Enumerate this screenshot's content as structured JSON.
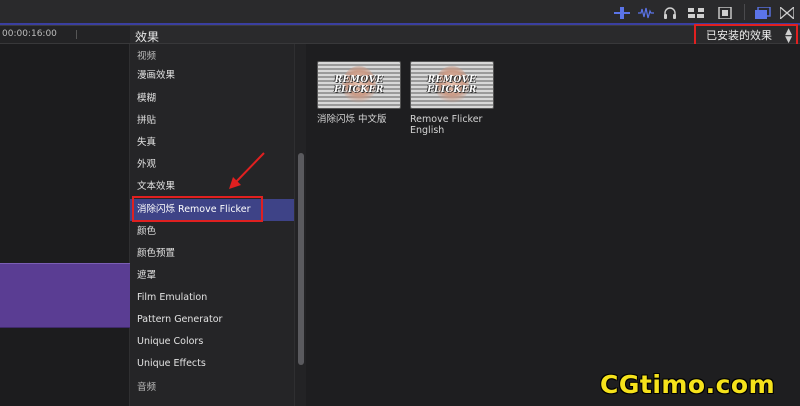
{
  "toolbar": {
    "icons": [
      "skimming-icon",
      "audio-skimming-icon",
      "headphones-icon",
      "snapping-icon",
      "clip-appearance-icon",
      "browser-toggle-icon",
      "transitions-icon"
    ]
  },
  "timeline": {
    "timecode": "00:00:16:00"
  },
  "effects": {
    "title": "效果",
    "filter_label": "已安装的效果",
    "categories": [
      {
        "label": "视频"
      },
      {
        "label": "漫画效果"
      },
      {
        "label": "模糊"
      },
      {
        "label": "拼贴"
      },
      {
        "label": "失真"
      },
      {
        "label": "外观"
      },
      {
        "label": "文本效果"
      },
      {
        "label": "消除闪烁 Remove Flicker"
      },
      {
        "label": "颜色"
      },
      {
        "label": "颜色预置"
      },
      {
        "label": "遮罩"
      },
      {
        "label": "Film Emulation"
      },
      {
        "label": "Pattern Generator"
      },
      {
        "label": "Unique Colors"
      },
      {
        "label": "Unique Effects"
      },
      {
        "label": "音频"
      }
    ],
    "selected_index": 7,
    "tiles": [
      {
        "name": "消除闪烁 中文版",
        "thumb_text": "REMOVE FLICKER"
      },
      {
        "name": "Remove Flicker English",
        "thumb_text": "REMOVE FLICKER"
      }
    ]
  },
  "watermark": "CGtimo.com",
  "colors": {
    "accent": "#3e4387",
    "annotation": "#e02020",
    "clip": "#5a3d93",
    "watermark": "#f5e21b"
  }
}
